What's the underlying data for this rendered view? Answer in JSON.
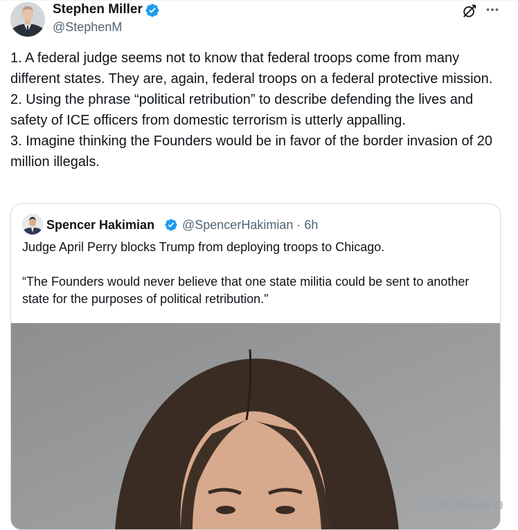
{
  "tweet": {
    "author_name": "Stephen Miller",
    "author_handle": "@StephenM",
    "verified": true,
    "icons": [
      "grok-icon",
      "more-icon"
    ],
    "body": [
      "1. A federal judge seems not to know that federal troops come from many different states. They are, again, federal troops on a federal protective mission.",
      "2. Using the phrase “political retribution” to describe defending the lives and safety of ICE officers from domestic terrorism is utterly appalling.",
      "3. Imagine thinking the Founders would be in favor of the border invasion of 20 million illegals."
    ]
  },
  "quote": {
    "author_name": "Spencer Hakimian",
    "author_handle": "@SpencerHakimian",
    "separator": "·",
    "time": "6h",
    "verified": true,
    "text_line1": "Judge April Perry blocks Trump from deploying troops to Chicago.",
    "text_line2": "“The Founders would never believe that one state militia could be sent to another state for the purposes of political retribution.\""
  },
  "colors": {
    "verified_blue": "#1d9bf0",
    "secondary_text": "#536471",
    "border": "#cfd9de"
  }
}
